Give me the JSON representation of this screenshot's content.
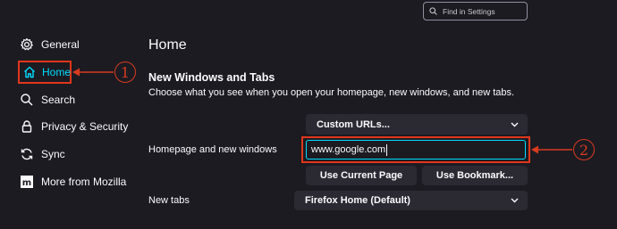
{
  "search": {
    "placeholder": "Find in Settings"
  },
  "sidebar": {
    "items": [
      {
        "label": "General",
        "icon": "gear-icon"
      },
      {
        "label": "Home",
        "icon": "home-icon",
        "selected": true
      },
      {
        "label": "Search",
        "icon": "search-icon"
      },
      {
        "label": "Privacy & Security",
        "icon": "lock-icon"
      },
      {
        "label": "Sync",
        "icon": "sync-icon"
      },
      {
        "label": "More from Mozilla",
        "icon": "mozilla-icon"
      }
    ]
  },
  "main": {
    "title": "Home",
    "section_title": "New Windows and Tabs",
    "section_desc": "Choose what you see when you open your homepage, new windows, and new tabs.",
    "homepage": {
      "select_value": "Custom URLs...",
      "label": "Homepage and new windows",
      "url_value": "www.google.com",
      "use_current_label": "Use Current Page",
      "use_bookmark_label": "Use Bookmark..."
    },
    "new_tabs": {
      "label": "New tabs",
      "select_value": "Firefox Home (Default)"
    }
  },
  "annotations": {
    "step1": "1",
    "step2": "2"
  },
  "colors": {
    "background": "#1c1b22",
    "accent": "#00ddff",
    "annotation": "#e0361b",
    "control": "#2b2a33"
  }
}
